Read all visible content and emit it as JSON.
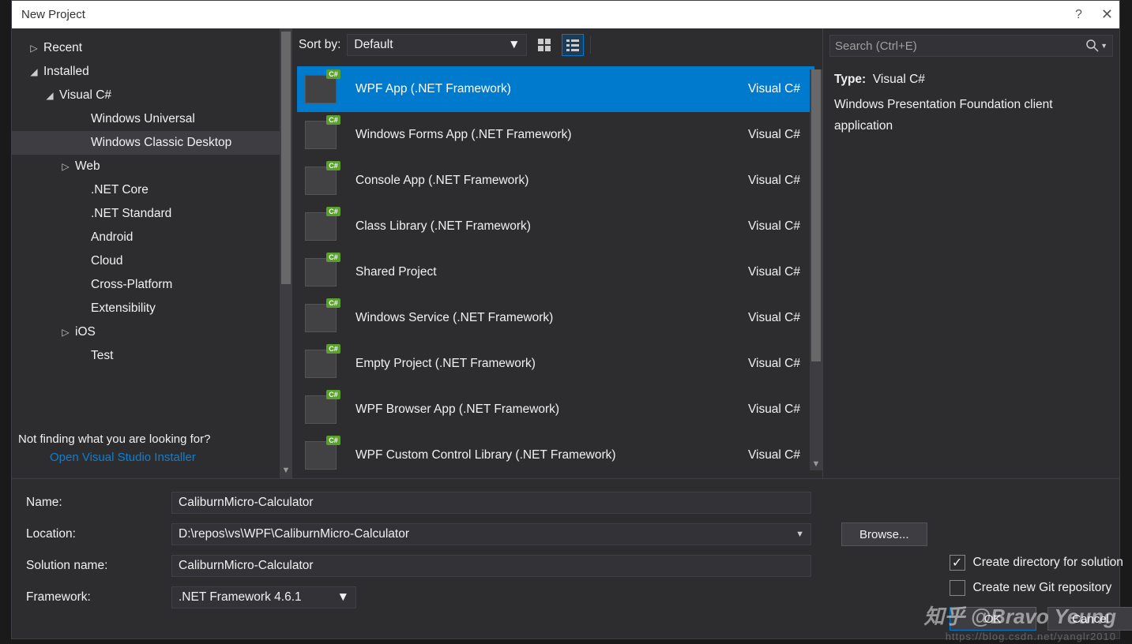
{
  "window": {
    "title": "New Project"
  },
  "sidebar": {
    "items": [
      {
        "label": "Recent",
        "indent": 0,
        "exp": "▷"
      },
      {
        "label": "Installed",
        "indent": 0,
        "exp": "◢"
      },
      {
        "label": "Visual C#",
        "indent": 1,
        "exp": "◢"
      },
      {
        "label": "Windows Universal",
        "indent": 3,
        "exp": ""
      },
      {
        "label": "Windows Classic Desktop",
        "indent": 3,
        "exp": "",
        "selected": true
      },
      {
        "label": "Web",
        "indent": 2,
        "exp": "▷"
      },
      {
        "label": ".NET Core",
        "indent": 3,
        "exp": ""
      },
      {
        "label": ".NET Standard",
        "indent": 3,
        "exp": ""
      },
      {
        "label": "Android",
        "indent": 3,
        "exp": ""
      },
      {
        "label": "Cloud",
        "indent": 3,
        "exp": ""
      },
      {
        "label": "Cross-Platform",
        "indent": 3,
        "exp": ""
      },
      {
        "label": "Extensibility",
        "indent": 3,
        "exp": ""
      },
      {
        "label": "iOS",
        "indent": 2,
        "exp": "▷"
      },
      {
        "label": "Test",
        "indent": 3,
        "exp": ""
      }
    ],
    "hint": "Not finding what you are looking for?",
    "link": "Open Visual Studio Installer"
  },
  "center": {
    "sort_label": "Sort by:",
    "sort_value": "Default",
    "templates": [
      {
        "name": "WPF App (.NET Framework)",
        "lang": "Visual C#",
        "selected": true
      },
      {
        "name": "Windows Forms App (.NET Framework)",
        "lang": "Visual C#"
      },
      {
        "name": "Console App (.NET Framework)",
        "lang": "Visual C#"
      },
      {
        "name": "Class Library (.NET Framework)",
        "lang": "Visual C#"
      },
      {
        "name": "Shared Project",
        "lang": "Visual C#"
      },
      {
        "name": "Windows Service (.NET Framework)",
        "lang": "Visual C#"
      },
      {
        "name": "Empty Project (.NET Framework)",
        "lang": "Visual C#"
      },
      {
        "name": "WPF Browser App (.NET Framework)",
        "lang": "Visual C#"
      },
      {
        "name": "WPF Custom Control Library (.NET Framework)",
        "lang": "Visual C#"
      }
    ],
    "badge": "C#"
  },
  "right": {
    "search_placeholder": "Search (Ctrl+E)",
    "type_label": "Type:",
    "type_value": "Visual C#",
    "desc": "Windows Presentation Foundation client application"
  },
  "form": {
    "name_label": "Name:",
    "name_value": "CaliburnMicro-Calculator",
    "location_label": "Location:",
    "location_value": "D:\\repos\\vs\\WPF\\CaliburnMicro-Calculator",
    "browse_label": "Browse...",
    "solution_label": "Solution name:",
    "solution_value": "CaliburnMicro-Calculator",
    "framework_label": "Framework:",
    "framework_value": ".NET Framework 4.6.1",
    "create_dir": "Create directory for solution",
    "create_git": "Create new Git repository",
    "ok": "OK",
    "cancel": "Cancel"
  },
  "watermark": "知乎 @Bravo Yeung",
  "watermark2": "https://blog.csdn.net/yanglr2010"
}
